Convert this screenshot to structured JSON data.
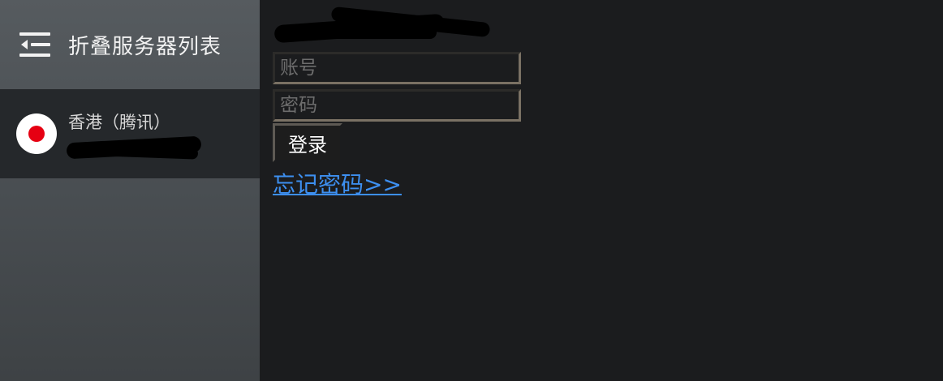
{
  "sidebar": {
    "toggle_icon": "collapse-list-icon",
    "title": "折叠服务器列表",
    "servers": [
      {
        "name": "香港（腾讯）",
        "address": "",
        "flag": "japan-flag-icon",
        "flag_color": "#e60012",
        "selected": true
      }
    ]
  },
  "form": {
    "title": "",
    "username_placeholder": "账号",
    "username_value": "",
    "password_placeholder": "密码",
    "password_value": "",
    "login_label": "登录",
    "forgot_label": "忘记密码>>"
  },
  "colors": {
    "background": "#1b1c1e",
    "sidebar": "#4a4f53",
    "selected_item": "#25282b",
    "link": "#3d8ff0",
    "input_border": "#7a7164"
  }
}
